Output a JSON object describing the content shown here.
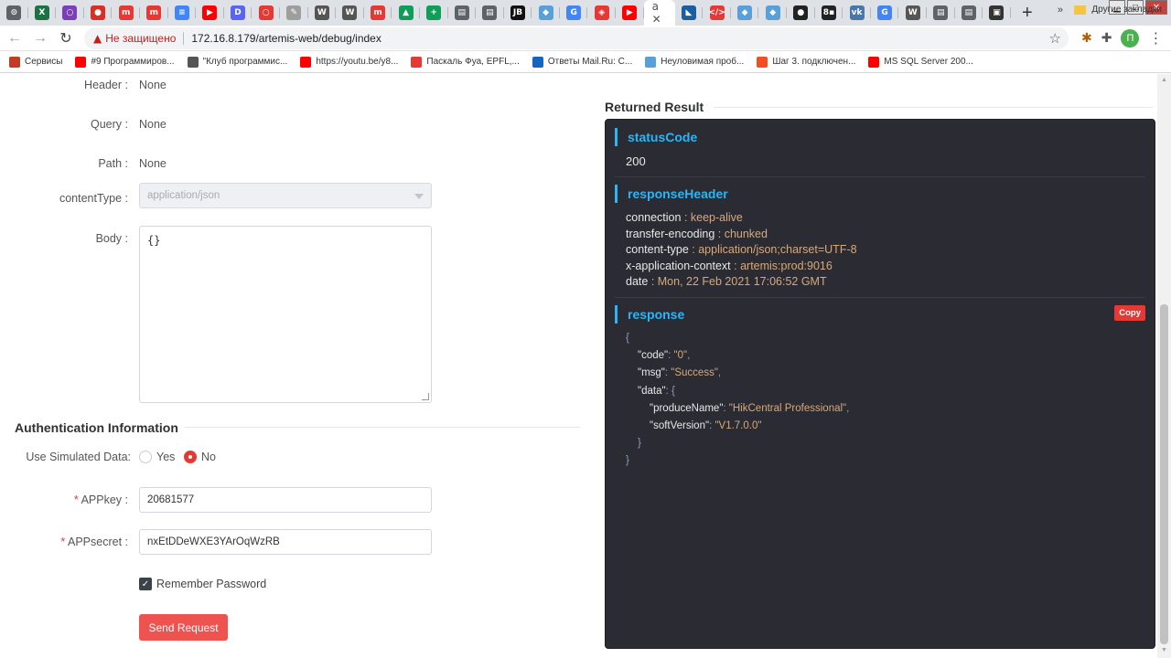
{
  "tabs": [
    {
      "glyph": "⊙",
      "color": "#5f6368"
    },
    {
      "glyph": "X",
      "color": "#1e7145"
    },
    {
      "glyph": "○",
      "color": "#7b3fb8"
    },
    {
      "glyph": "●",
      "color": "#d93025"
    },
    {
      "glyph": "m",
      "color": "#e53935"
    },
    {
      "glyph": "m",
      "color": "#e53935"
    },
    {
      "glyph": "≡",
      "color": "#4285f4"
    },
    {
      "glyph": "▶",
      "color": "#ff0000"
    },
    {
      "glyph": "D",
      "color": "#5865f2"
    },
    {
      "glyph": "○",
      "color": "#e53935"
    },
    {
      "glyph": "✎",
      "color": "#9e9e9e"
    },
    {
      "glyph": "W",
      "color": "#555555"
    },
    {
      "glyph": "W",
      "color": "#555555"
    },
    {
      "glyph": "m",
      "color": "#e53935"
    },
    {
      "glyph": "▲",
      "color": "#0f9d58"
    },
    {
      "glyph": "+",
      "color": "#0f9d58"
    },
    {
      "glyph": "▤",
      "color": "#5f6368"
    },
    {
      "glyph": "▤",
      "color": "#5f6368"
    },
    {
      "glyph": "JB",
      "color": "#111111"
    },
    {
      "glyph": "◆",
      "color": "#5aa0d8"
    },
    {
      "glyph": "G",
      "color": "#4285f4"
    },
    {
      "glyph": "◈",
      "color": "#e53935"
    },
    {
      "glyph": "▶",
      "color": "#ff0000"
    },
    {
      "glyph": "a ✕",
      "color": "#ffffff",
      "active": true
    },
    {
      "glyph": "◣",
      "color": "#1a5fa0"
    },
    {
      "glyph": "</>",
      "color": "#e53935"
    },
    {
      "glyph": "◆",
      "color": "#5aa0d8"
    },
    {
      "glyph": "◆",
      "color": "#5aa0d8"
    },
    {
      "glyph": "●",
      "color": "#222222"
    },
    {
      "glyph": "8▪",
      "color": "#222222"
    },
    {
      "glyph": "vk",
      "color": "#4a76a8"
    },
    {
      "glyph": "G",
      "color": "#4285f4"
    },
    {
      "glyph": "W",
      "color": "#555555"
    },
    {
      "glyph": "▤",
      "color": "#5f6368"
    },
    {
      "glyph": "▤",
      "color": "#5f6368"
    },
    {
      "glyph": "▣",
      "color": "#333333"
    }
  ],
  "address": {
    "security_label": "Не защищено",
    "url": "172.16.8.179/artemis-web/debug/index",
    "profile_initial": "П"
  },
  "bookmarks": [
    {
      "label": "Сервисы",
      "color": "#c23b22"
    },
    {
      "label": "#9 Программиров...",
      "color": "#ff0000"
    },
    {
      "label": "\"Клуб программис...",
      "color": "#555555"
    },
    {
      "label": "https://youtu.be/y8...",
      "color": "#ff0000"
    },
    {
      "label": "Паскаль Фуа, EPFL,...",
      "color": "#e53935"
    },
    {
      "label": "Ответы Mail.Ru: С...",
      "color": "#1565c0"
    },
    {
      "label": "Неуловимая проб...",
      "color": "#5aa0d8"
    },
    {
      "label": "Шаг 3. подключен...",
      "color": "#f25022"
    },
    {
      "label": "MS SQL Server 200...",
      "color": "#ff0000"
    }
  ],
  "bookmarks_more": "»",
  "bookmarks_other": "Другие закладки",
  "form": {
    "header_label": "Header :",
    "header_value": "None",
    "query_label": "Query :",
    "query_value": "None",
    "path_label": "Path :",
    "path_value": "None",
    "content_type_label": "contentType :",
    "content_type_value": "application/json",
    "body_label": "Body :",
    "body_value": "{}"
  },
  "auth": {
    "title": "Authentication Information",
    "simulated_label": "Use Simulated Data:",
    "yes_label": "Yes",
    "no_label": "No",
    "appkey_label": "APPkey :",
    "appkey_value": "20681577",
    "appsecret_label": "APPsecret :",
    "appsecret_value": "nxEtDDeWXE3YArOqWzRB",
    "remember_label": "Remember Password",
    "send_label": "Send Request"
  },
  "result": {
    "title": "Returned Result",
    "status_code_title": "statusCode",
    "status_code_value": "200",
    "response_header_title": "responseHeader",
    "headers": [
      {
        "key": "connection",
        "value": "keep-alive"
      },
      {
        "key": "transfer-encoding",
        "value": "chunked"
      },
      {
        "key": "content-type",
        "value": "application/json;charset=UTF-8"
      },
      {
        "key": "x-application-context",
        "value": "artemis:prod:9016"
      },
      {
        "key": "date",
        "value": "Mon, 22 Feb 2021 17:06:52 GMT"
      }
    ],
    "response_title": "response",
    "copy_label": "Copy",
    "response_json": [
      {
        "indent": 0,
        "punct": "{"
      },
      {
        "indent": 1,
        "key": "\"code\"",
        "value": "\"0\"",
        "comma": ","
      },
      {
        "indent": 1,
        "key": "\"msg\"",
        "value": "\"Success\"",
        "comma": ","
      },
      {
        "indent": 1,
        "key": "\"data\"",
        "punct_after": "{"
      },
      {
        "indent": 2,
        "key": "\"produceName\"",
        "value": "\"HikCentral Professional\"",
        "comma": ","
      },
      {
        "indent": 2,
        "key": "\"softVersion\"",
        "value": "\"V1.7.0.0\""
      },
      {
        "indent": 1,
        "punct": "}"
      },
      {
        "indent": 0,
        "punct": "}"
      }
    ]
  }
}
